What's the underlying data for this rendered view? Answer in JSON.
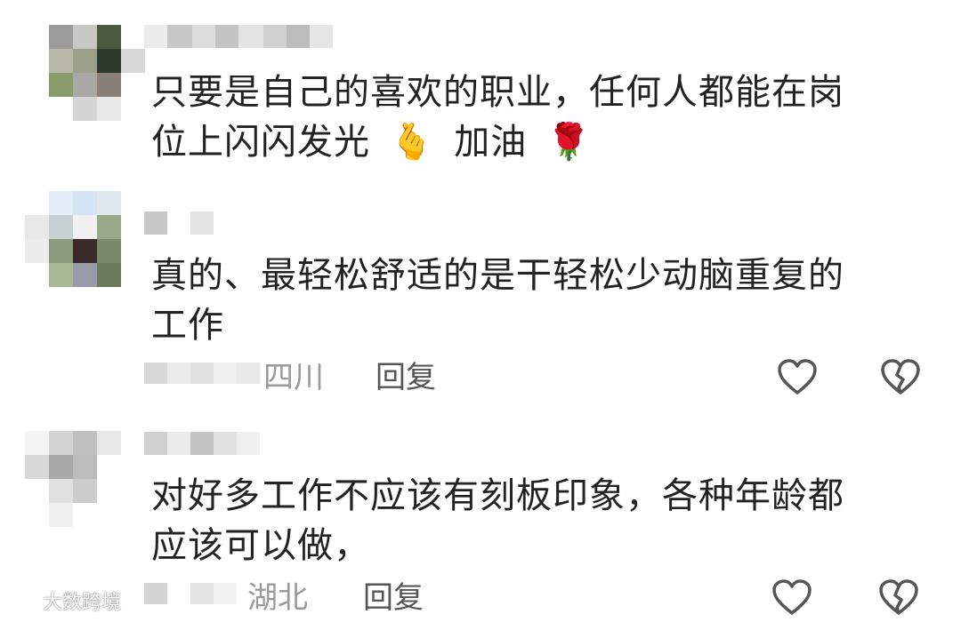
{
  "comments": [
    {
      "text_line1": "只要是自己的喜欢的职业，任何人都能在岗",
      "text_line2_a": "位上闪闪发光",
      "emoji_1": "🫰",
      "text_line2_b": "加油",
      "emoji_2": "🌹"
    },
    {
      "text_line1": "真的、最轻松舒适的是干轻松少动脑重复的",
      "text_line2": "工作",
      "location": "四川",
      "reply_label": "回复"
    },
    {
      "text_line1": "对好多工作不应该有刻板印象，各种年龄都",
      "text_line2": "应该可以做，",
      "location": "湖北",
      "reply_label": "回复"
    }
  ],
  "watermark": {
    "text": "大数跨境"
  },
  "colors": {
    "text": "#222222",
    "location": "#9a9a9a",
    "reply": "#555555",
    "icon_stroke": "#555555"
  },
  "icons": [
    "heart-outline-icon",
    "broken-heart-icon",
    "finger-heart-emoji",
    "rose-emoji"
  ]
}
